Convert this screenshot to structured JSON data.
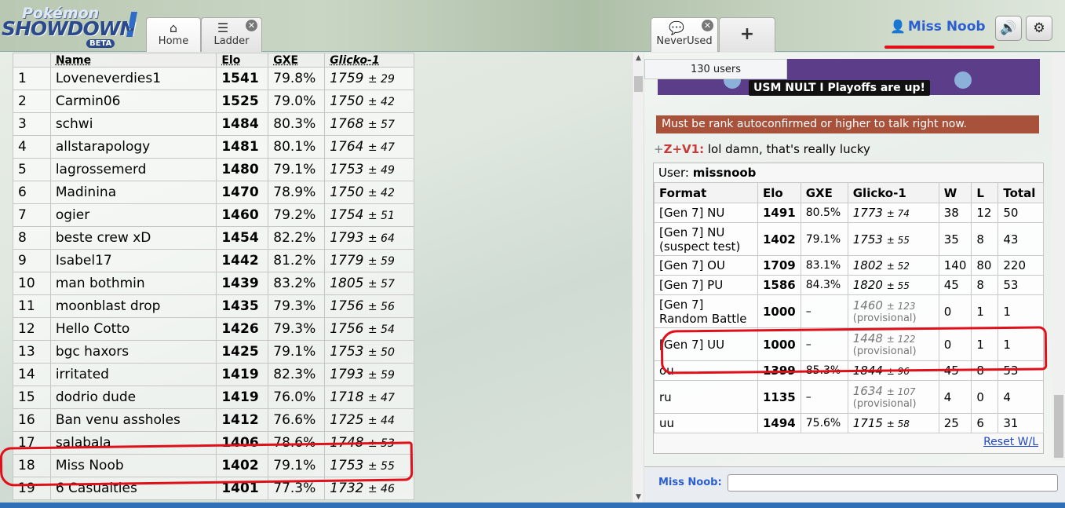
{
  "logo": {
    "top": "Pokémon",
    "main": "SHOWDOWN",
    "badge": "BETA",
    "bang": "!"
  },
  "tabs": [
    {
      "label": "Home",
      "icon": "home-icon"
    },
    {
      "label": "Ladder",
      "icon": "list-icon"
    },
    {
      "label": "NeverUsed",
      "icon": "chat-bubble-icon"
    },
    {
      "label": "+"
    }
  ],
  "user": {
    "name": "Miss Noob"
  },
  "ladder": {
    "headers": [
      "Name",
      "Elo",
      "GXE",
      "Glicko-1"
    ],
    "rows": [
      [
        "1",
        "Loveneverdies1",
        "1541",
        "79.8%",
        "1759",
        "± 29"
      ],
      [
        "2",
        "Carmin06",
        "1525",
        "79.0%",
        "1750",
        "± 42"
      ],
      [
        "3",
        "schwi",
        "1484",
        "80.3%",
        "1768",
        "± 57"
      ],
      [
        "4",
        "allstarapology",
        "1481",
        "80.1%",
        "1764",
        "± 47"
      ],
      [
        "5",
        "lagrossemerd",
        "1480",
        "79.1%",
        "1753",
        "± 49"
      ],
      [
        "6",
        "Madinina",
        "1470",
        "78.9%",
        "1750",
        "± 42"
      ],
      [
        "7",
        "ogier",
        "1460",
        "79.2%",
        "1754",
        "± 51"
      ],
      [
        "8",
        "beste crew xD",
        "1454",
        "82.2%",
        "1793",
        "± 64"
      ],
      [
        "9",
        "Isabel17",
        "1442",
        "81.2%",
        "1779",
        "± 59"
      ],
      [
        "10",
        "man bothmin",
        "1439",
        "83.2%",
        "1805",
        "± 57"
      ],
      [
        "11",
        "moonblast drop",
        "1435",
        "79.3%",
        "1756",
        "± 56"
      ],
      [
        "12",
        "Hello Cotto",
        "1426",
        "79.3%",
        "1756",
        "± 54"
      ],
      [
        "13",
        "bgc haxors",
        "1425",
        "79.1%",
        "1753",
        "± 50"
      ],
      [
        "14",
        "irritated",
        "1419",
        "82.3%",
        "1793",
        "± 59"
      ],
      [
        "15",
        "dodrio dude",
        "1419",
        "76.0%",
        "1718",
        "± 47"
      ],
      [
        "16",
        "Ban venu assholes",
        "1412",
        "76.6%",
        "1725",
        "± 44"
      ],
      [
        "17",
        "salabala",
        "1406",
        "78.6%",
        "1748",
        "± 53"
      ],
      [
        "18",
        "Miss Noob",
        "1402",
        "79.1%",
        "1753",
        "± 55"
      ],
      [
        "19",
        "6 Casualties",
        "1401",
        "77.3%",
        "1732",
        "± 46"
      ]
    ]
  },
  "chat": {
    "users_count": "130 users",
    "banner_text": "USM NULT I Playoffs are up!",
    "rank_message": "Must be rank autoconfirmed or higher to talk right now.",
    "message": {
      "user_prefix": "+",
      "user": "Z+V1:",
      "text": "lol damn, that's really lucky"
    },
    "profile": {
      "label": "User:",
      "username": "missnoob",
      "headers": [
        "Format",
        "Elo",
        "GXE",
        "Glicko-1",
        "W",
        "L",
        "Total"
      ],
      "rows": [
        [
          "[Gen 7] NU",
          "",
          "1491",
          "80.5%",
          "1773",
          "± 74",
          "38",
          "12",
          "50",
          ""
        ],
        [
          "[Gen 7] NU",
          "(suspect test)",
          "1402",
          "79.1%",
          "1753",
          "± 55",
          "35",
          "8",
          "43",
          ""
        ],
        [
          "[Gen 7] OU",
          "",
          "1709",
          "83.1%",
          "1802",
          "± 52",
          "140",
          "80",
          "220",
          ""
        ],
        [
          "[Gen 7] PU",
          "",
          "1586",
          "84.3%",
          "1820",
          "± 55",
          "45",
          "8",
          "53",
          ""
        ],
        [
          "[Gen 7]",
          "Random Battle",
          "1000",
          "–",
          "1460",
          "± 123",
          "0",
          "1",
          "1",
          "(provisional)"
        ],
        [
          "[Gen 7] UU",
          "",
          "1000",
          "–",
          "1448",
          "± 122",
          "0",
          "1",
          "1",
          "(provisional)"
        ],
        [
          "ou",
          "",
          "1399",
          "85.3%",
          "1844",
          "± 96",
          "45",
          "8",
          "53",
          ""
        ],
        [
          "ru",
          "",
          "1135",
          "–",
          "1634",
          "± 107",
          "4",
          "0",
          "4",
          "(provisional)"
        ],
        [
          "uu",
          "",
          "1494",
          "75.6%",
          "1715",
          "± 58",
          "25",
          "6",
          "31",
          ""
        ]
      ],
      "reset_link": "Reset W/L"
    },
    "input_label": "Miss Noob:"
  }
}
